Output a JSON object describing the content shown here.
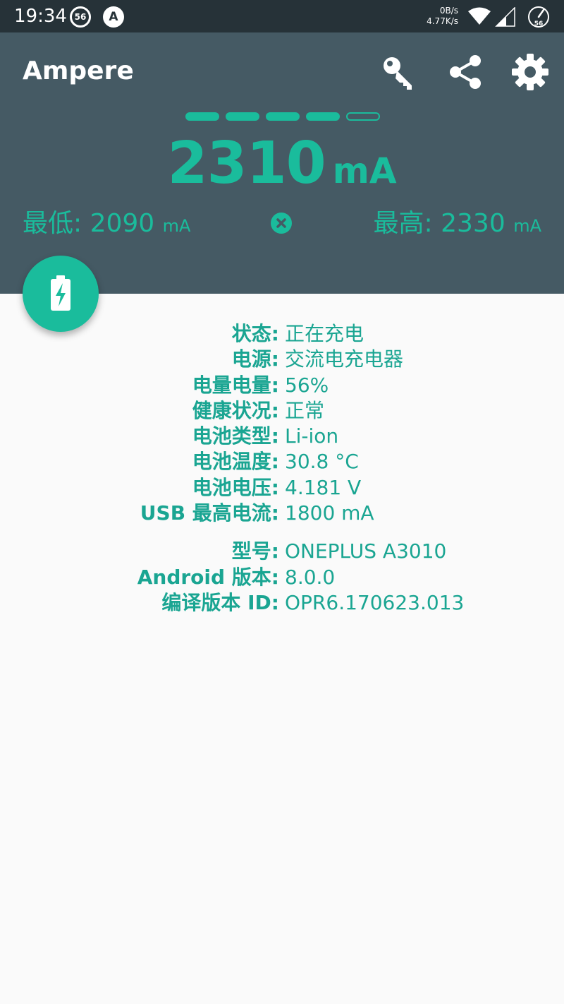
{
  "status_bar": {
    "time": "19:34",
    "badge_56": "56",
    "badge_a": "A",
    "net_down": "0B/s",
    "net_up": "4.77K/s",
    "battery_circle": "56"
  },
  "toolbar": {
    "title": "Ampere",
    "icons": [
      "key-icon",
      "share-icon",
      "gear-icon"
    ]
  },
  "meter": {
    "level_filled": 4,
    "level_total": 5,
    "current_value": "2310",
    "current_unit": "mA",
    "min_label": "最低:",
    "min_value": "2090",
    "min_unit": "mA",
    "max_label": "最高:",
    "max_value": "2330",
    "max_unit": "mA",
    "accent": "#1abc9c"
  },
  "battery_info": [
    {
      "label": "状态:",
      "value": "正在充电"
    },
    {
      "label": "电源:",
      "value": "交流电充电器"
    },
    {
      "label": "电量电量:",
      "value": "56%"
    },
    {
      "label": "健康状况:",
      "value": "正常"
    },
    {
      "label": "电池类型:",
      "value": "Li-ion"
    },
    {
      "label": "电池温度:",
      "value": "30.8 °C"
    },
    {
      "label": "电池电压:",
      "value": "4.181 V"
    },
    {
      "label": "USB 最高电流:",
      "value": "1800 mA"
    }
  ],
  "device_info": [
    {
      "label": "型号:",
      "value": "ONEPLUS A3010"
    },
    {
      "label": "Android 版本:",
      "value": "8.0.0"
    },
    {
      "label": "编译版本 ID:",
      "value": "OPR6.170623.013"
    }
  ],
  "colors": {
    "status_bar": "#263238",
    "header": "#455a64",
    "accent": "#1abc9c",
    "background": "#fafafa"
  }
}
